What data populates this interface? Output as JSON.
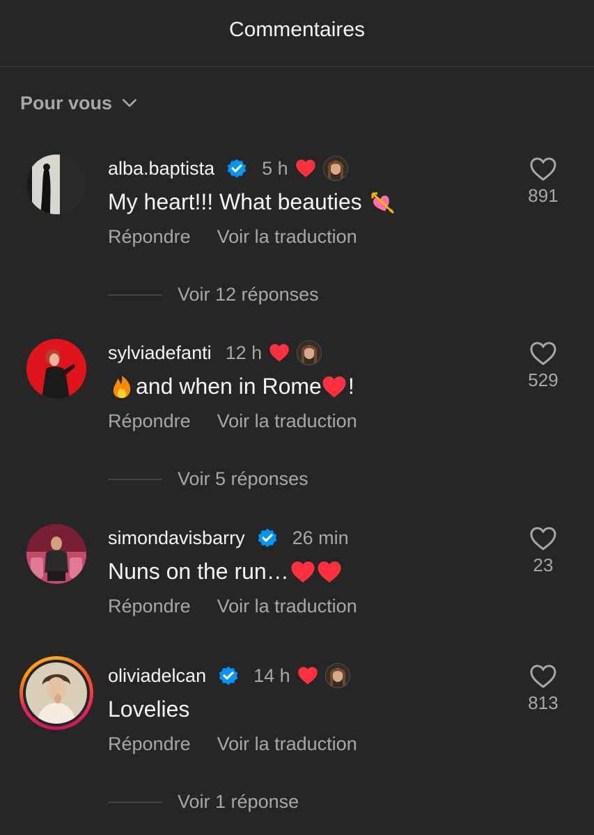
{
  "header": {
    "title": "Commentaires"
  },
  "sort": {
    "label": "Pour vous"
  },
  "colors": {
    "background": "#262626",
    "liked_heart": "#ff3040",
    "verified": "#0095f6",
    "secondary_text": "#a8a8a8"
  },
  "comments": [
    {
      "username": "alba.baptista",
      "verified": true,
      "time": "5 h",
      "liked_by_author": true,
      "text": "My heart!!! What beauties",
      "text_emoji": "heart-with-arrow",
      "reply_label": "Répondre",
      "translate_label": "Voir la traduction",
      "likes": "891",
      "view_replies": "Voir 12 réponses"
    },
    {
      "username": "sylviadefanti",
      "verified": false,
      "time": "12 h",
      "liked_by_author": true,
      "text_pre": "",
      "text": "and when in Rome",
      "text_post": "!",
      "reply_label": "Répondre",
      "translate_label": "Voir la traduction",
      "likes": "529",
      "view_replies": "Voir 5 réponses"
    },
    {
      "username": "simondavisbarry",
      "verified": true,
      "time": "26 min",
      "liked_by_author": false,
      "text": "Nuns on the run…",
      "reply_label": "Répondre",
      "translate_label": "Voir la traduction",
      "likes": "23"
    },
    {
      "username": "oliviadelcan",
      "verified": true,
      "time": "14 h",
      "liked_by_author": true,
      "text": "Lovelies",
      "reply_label": "Répondre",
      "translate_label": "Voir la traduction",
      "likes": "813",
      "view_replies": "Voir 1 réponse"
    }
  ]
}
